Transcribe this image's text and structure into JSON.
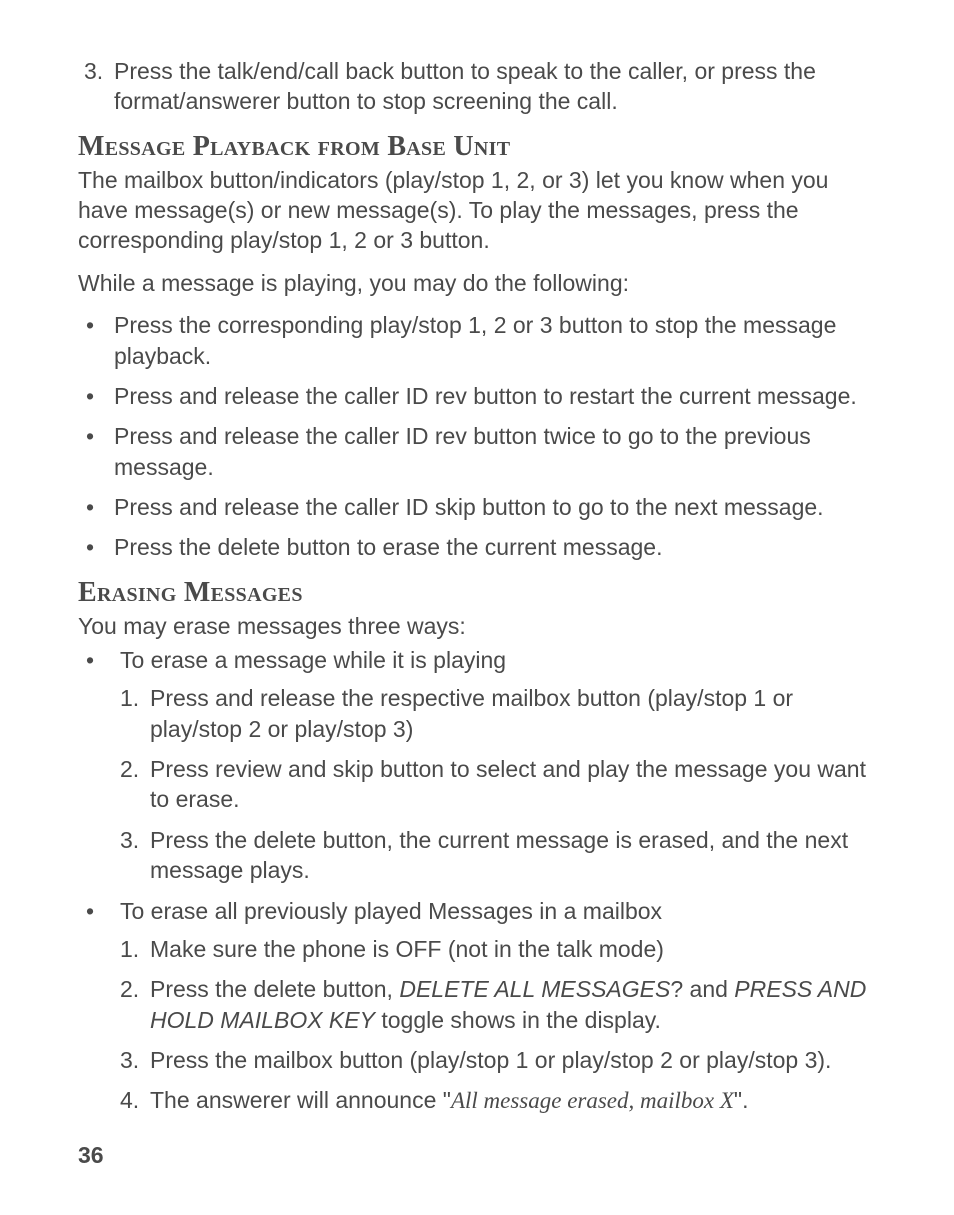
{
  "top_step3": "Press the talk/end/call back button to speak to the caller, or press the format/answerer button to stop screening the call.",
  "section1": {
    "heading": "Message Playback from Base Unit",
    "intro": "The mailbox button/indicators (play/stop 1, 2, or 3) let you know when you have message(s) or new message(s). To play the messages, press the corresponding play/stop 1, 2 or 3 button.",
    "lead": "While a message is playing, you may do the following:",
    "bullets": [
      "Press the corresponding play/stop 1, 2 or 3 button to stop the message playback.",
      "Press and release the caller  ID rev button to restart the current message.",
      "Press and release the caller  ID rev button twice to go to the previous message.",
      "Press and release the caller  ID skip button to go to the next message.",
      "Press the delete button to erase the current message."
    ]
  },
  "section2": {
    "heading": "Erasing Messages",
    "intro": "You may erase messages three ways:",
    "group1": {
      "title": "To erase a message while it is playing",
      "steps": [
        "Press and release the respective mailbox button (play/stop 1 or play/stop 2 or play/stop 3)",
        "Press review and skip button to select and play the message you want to erase.",
        "Press the delete button, the current message is erased, and the next message plays."
      ]
    },
    "group2": {
      "title": "To erase all previously played Messages in a mailbox",
      "step1": "Make sure the phone is OFF (not in the talk mode)",
      "step2_pre": "Press the delete button, ",
      "step2_it1": "DELETE ALL MESSAGES",
      "step2_mid": "? and ",
      "step2_it2": "PRESS AND HOLD MAILBOX KEY",
      "step2_post": " toggle shows in the display.",
      "step3": "Press the mailbox button (play/stop 1 or play/stop 2 or play/stop 3).",
      "step4_pre": "The answerer will announce \"",
      "step4_it": "All message erased, mailbox X",
      "step4_post": "\"."
    }
  },
  "pagenum": "36"
}
